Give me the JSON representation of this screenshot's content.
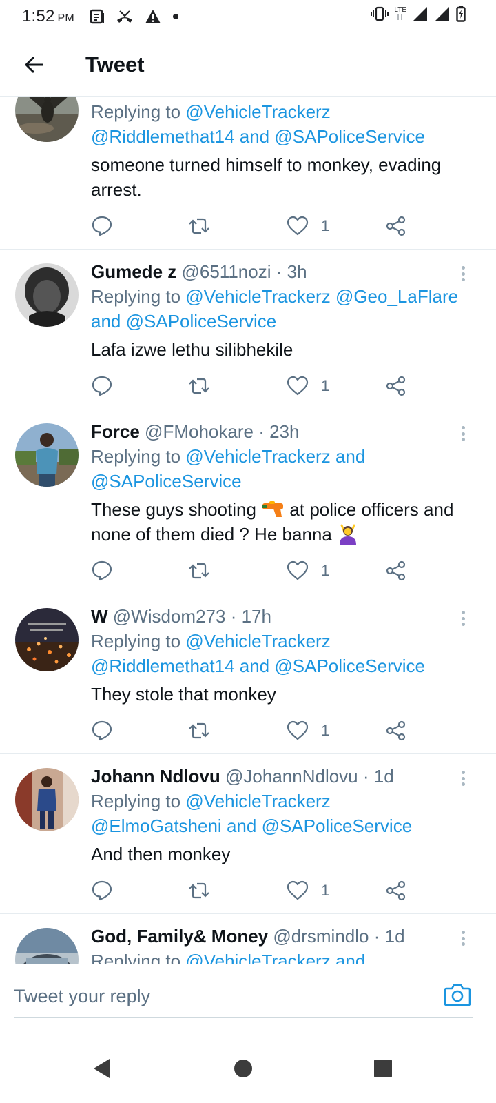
{
  "status_bar": {
    "time": "1:52",
    "ampm": "PM",
    "network": "LTE"
  },
  "header": {
    "title": "Tweet"
  },
  "tweets": [
    {
      "name": "",
      "handle": "",
      "time": "",
      "reply_prefix": "Replying to",
      "reply_line1": "@VehicleTrackerz",
      "reply_line2a": "@Riddlemethat14",
      "reply_and": "and",
      "reply_line2b": "@SAPoliceService",
      "text": "someone turned himself to monkey, evading arrest.",
      "likes": "1"
    },
    {
      "name": "Gumede z",
      "handle": "@6511nozi",
      "time": "3h",
      "reply_prefix": "Replying to",
      "reply_a": "@VehicleTrackerz",
      "reply_b": "@Geo_LaFlare",
      "reply_and": "and",
      "reply_c": "@SAPoliceService",
      "text": "Lafa izwe lethu silibhekile",
      "likes": "1"
    },
    {
      "name": "Force",
      "handle": "@FMohokare",
      "time": "23h",
      "reply_prefix": "Replying to",
      "reply_a": "@VehicleTrackerz",
      "reply_and": "and",
      "reply_b": "@SAPoliceService",
      "text_part1": "These guys shooting",
      "text_part2": "at police officers and none of them died ? He banna",
      "likes": "1"
    },
    {
      "name": "W",
      "handle": "@Wisdom273",
      "time": "17h",
      "reply_prefix": "Replying to",
      "reply_a": "@VehicleTrackerz",
      "reply_b": "@Riddlemethat14",
      "reply_and": "and",
      "reply_c": "@SAPoliceService",
      "text": "They stole that monkey",
      "likes": "1"
    },
    {
      "name": "Johann Ndlovu",
      "handle": "@JohannNdlovu",
      "time": "1d",
      "reply_prefix": "Replying to",
      "reply_a": "@VehicleTrackerz",
      "reply_b": "@ElmoGatsheni",
      "reply_and": "and",
      "reply_c": "@SAPoliceService",
      "text": "And then monkey",
      "likes": "1"
    },
    {
      "name": "God, Family& Money",
      "handle": "@drsmindlo",
      "time": "1d",
      "reply_prefix": "Replying to",
      "reply_a": "@VehicleTrackerz",
      "reply_and": "and"
    }
  ],
  "reply_bar": {
    "placeholder": "Tweet your reply"
  },
  "colors": {
    "link": "#1b95e0",
    "secondary_text": "#5b7083",
    "divider": "#e6ecf0"
  }
}
